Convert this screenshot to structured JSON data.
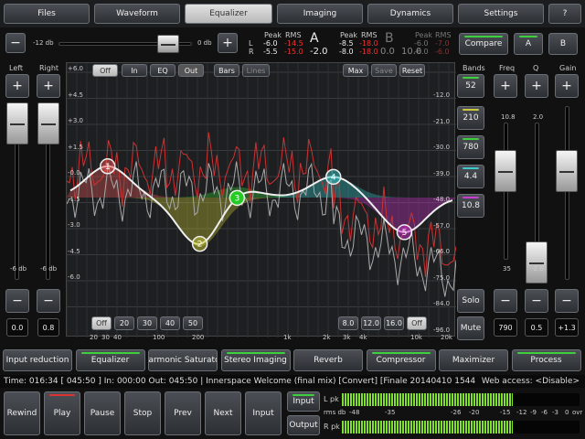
{
  "tabs": [
    {
      "label": "Files",
      "active": false
    },
    {
      "label": "Waveform",
      "active": false
    },
    {
      "label": "Equalizer",
      "active": true
    },
    {
      "label": "Imaging",
      "active": false
    },
    {
      "label": "Dynamics",
      "active": false
    },
    {
      "label": "Settings",
      "active": false
    },
    {
      "label": "?",
      "active": false
    }
  ],
  "gain": {
    "minus": "−",
    "plus": "+",
    "low_label": "-12 db",
    "high_label": "0 db"
  },
  "levels": {
    "peak_header": "Peak",
    "rms_header": "RMS",
    "A": {
      "name": "A",
      "L_peak": "-6.0",
      "L_rms": "-14.5",
      "R_peak": "-5.5",
      "R_rms": "-15.0",
      "value": "-2.0",
      "L": "L",
      "R": "R"
    },
    "B": {
      "name": "B",
      "L_peak": "-8.5",
      "L_rms": "-18.0",
      "R_peak": "-8.0",
      "R_rms": "-18.0",
      "value": "0.0",
      "L_peak2": "-6.0",
      "L_rms2": "-7.0",
      "R_peak2": "-6.0",
      "R_rms2": "-6.0",
      "extra": "10.0"
    }
  },
  "compare": {
    "compare": "Compare",
    "a": "A",
    "b": "B"
  },
  "channels": {
    "left": "Left",
    "right": "Right",
    "left_level": "-6 db",
    "right_level": "-6 db",
    "left_val": "0.0",
    "right_val": "0.8",
    "plus": "+",
    "minus": "−",
    "left_fader_pos": 0.05,
    "right_fader_pos": 0.05
  },
  "eq_buttons": {
    "off": "Off",
    "in": "In",
    "eq": "EQ",
    "out": "Out",
    "bars": "Bars",
    "lines": "Lines",
    "max": "Max",
    "save": "Save",
    "reset": "Reset"
  },
  "eq_left_scale": [
    "+6.0",
    "+4.5",
    "+3.0",
    "+1.5",
    "-0.0",
    "-1.5",
    "-3.0",
    "-4.5",
    "-6.0"
  ],
  "eq_right_scale": [
    "-12.0",
    "-21.0",
    "-30.0",
    "-39.0",
    "-48.0",
    "-57.0",
    "-66.0",
    "-75.0",
    "-84.0",
    "-96.0"
  ],
  "eq_freq_labels": [
    "20",
    "30",
    "40",
    "100",
    "200",
    "1k",
    "2k",
    "3k",
    "4k",
    "10k",
    "20k"
  ],
  "bottom_left_buttons": [
    "Off",
    "20",
    "30",
    "40",
    "50"
  ],
  "bottom_right_buttons": [
    "8.0",
    "12.0",
    "16.0",
    "Off"
  ],
  "bands": {
    "header": "Bands",
    "freq_header": "Freq",
    "q_header": "Q",
    "gain_header": "Gain",
    "values": [
      "52",
      "210",
      "780",
      "4.4",
      "10.8"
    ],
    "solo": "Solo",
    "mute": "Mute",
    "freq_top": "10.8",
    "freq_bottom": "35",
    "q_top": "2.0",
    "q_bottom": "-2.0",
    "freq_val": "790",
    "q_val": "0.5",
    "gain_val": "+1.3",
    "plus": "+",
    "minus": "−"
  },
  "eq_points": [
    {
      "label": "1",
      "freq_hz": 36,
      "gain_db": 1.8
    },
    {
      "label": "2",
      "freq_hz": 200,
      "gain_db": -2.8
    },
    {
      "label": "3",
      "freq_hz": 400,
      "gain_db": 0.6
    },
    {
      "label": "4",
      "freq_hz": 2400,
      "gain_db": 1.2
    },
    {
      "label": "5",
      "freq_hz": 9000,
      "gain_db": -2.0
    }
  ],
  "modules": [
    {
      "label": "Input reduction",
      "on": false
    },
    {
      "label": "Equalizer",
      "on": true
    },
    {
      "label": "Harmonic Saturator",
      "on": false
    },
    {
      "label": "Stereo Imaging",
      "on": true
    },
    {
      "label": "Reverb",
      "on": false
    },
    {
      "label": "Compressor",
      "on": true
    },
    {
      "label": "Maximizer",
      "on": false
    },
    {
      "label": "Process",
      "on": true
    }
  ],
  "status": {
    "text": "Time: 016:34  [ 045:50 ]  In: 000:00 Out: 045:50 | Innerspace Welcome (final mix) [Convert] [Finale 20140410 1544",
    "web": "Web access: <Disable>"
  },
  "transport": [
    "Rewind",
    "Play",
    "Pause",
    "Stop",
    "Prev",
    "Next",
    "Input"
  ],
  "io": {
    "input": "Input",
    "output": "Output"
  },
  "meters": {
    "L_label": "L pk",
    "R_label": "R pk",
    "rms_label": "rms db",
    "scale": [
      "-48",
      "-35",
      "-26",
      "-20",
      "-15",
      "-12",
      "-9",
      "-6",
      "-3",
      "0",
      "ovr"
    ],
    "L_level": 0.72,
    "R_level": 0.72
  }
}
